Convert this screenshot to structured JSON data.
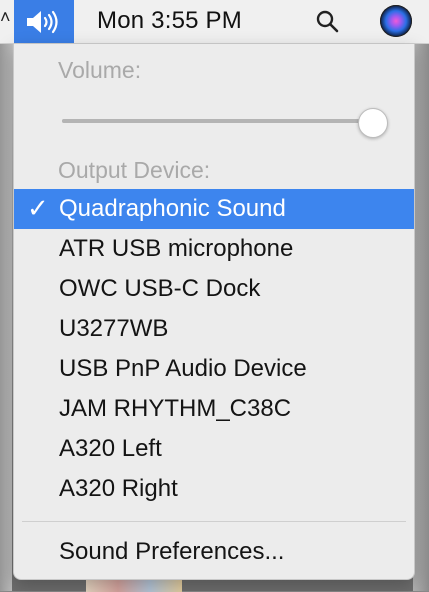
{
  "menu_bar": {
    "clock": "Mon 3:55 PM",
    "volume_icon": "speaker-volume-icon",
    "search_icon": "magnifying-glass-icon",
    "siri_icon": "siri-icon",
    "active_color": "#3a7ee6"
  },
  "sound_menu": {
    "volume_label": "Volume:",
    "volume_level_percent": 100,
    "output_label": "Output Device:",
    "check_glyph": "✓",
    "devices": [
      {
        "label": "Quadraphonic Sound",
        "selected": true
      },
      {
        "label": "ATR USB microphone",
        "selected": false
      },
      {
        "label": "OWC USB-C Dock",
        "selected": false
      },
      {
        "label": "U3277WB",
        "selected": false
      },
      {
        "label": "USB PnP Audio Device",
        "selected": false
      },
      {
        "label": "JAM RHYTHM_C38C",
        "selected": false
      },
      {
        "label": "A320 Left",
        "selected": false
      },
      {
        "label": "A320 Right",
        "selected": false
      }
    ],
    "preferences_label": "Sound Preferences...",
    "selection_color": "#3d85ee"
  }
}
